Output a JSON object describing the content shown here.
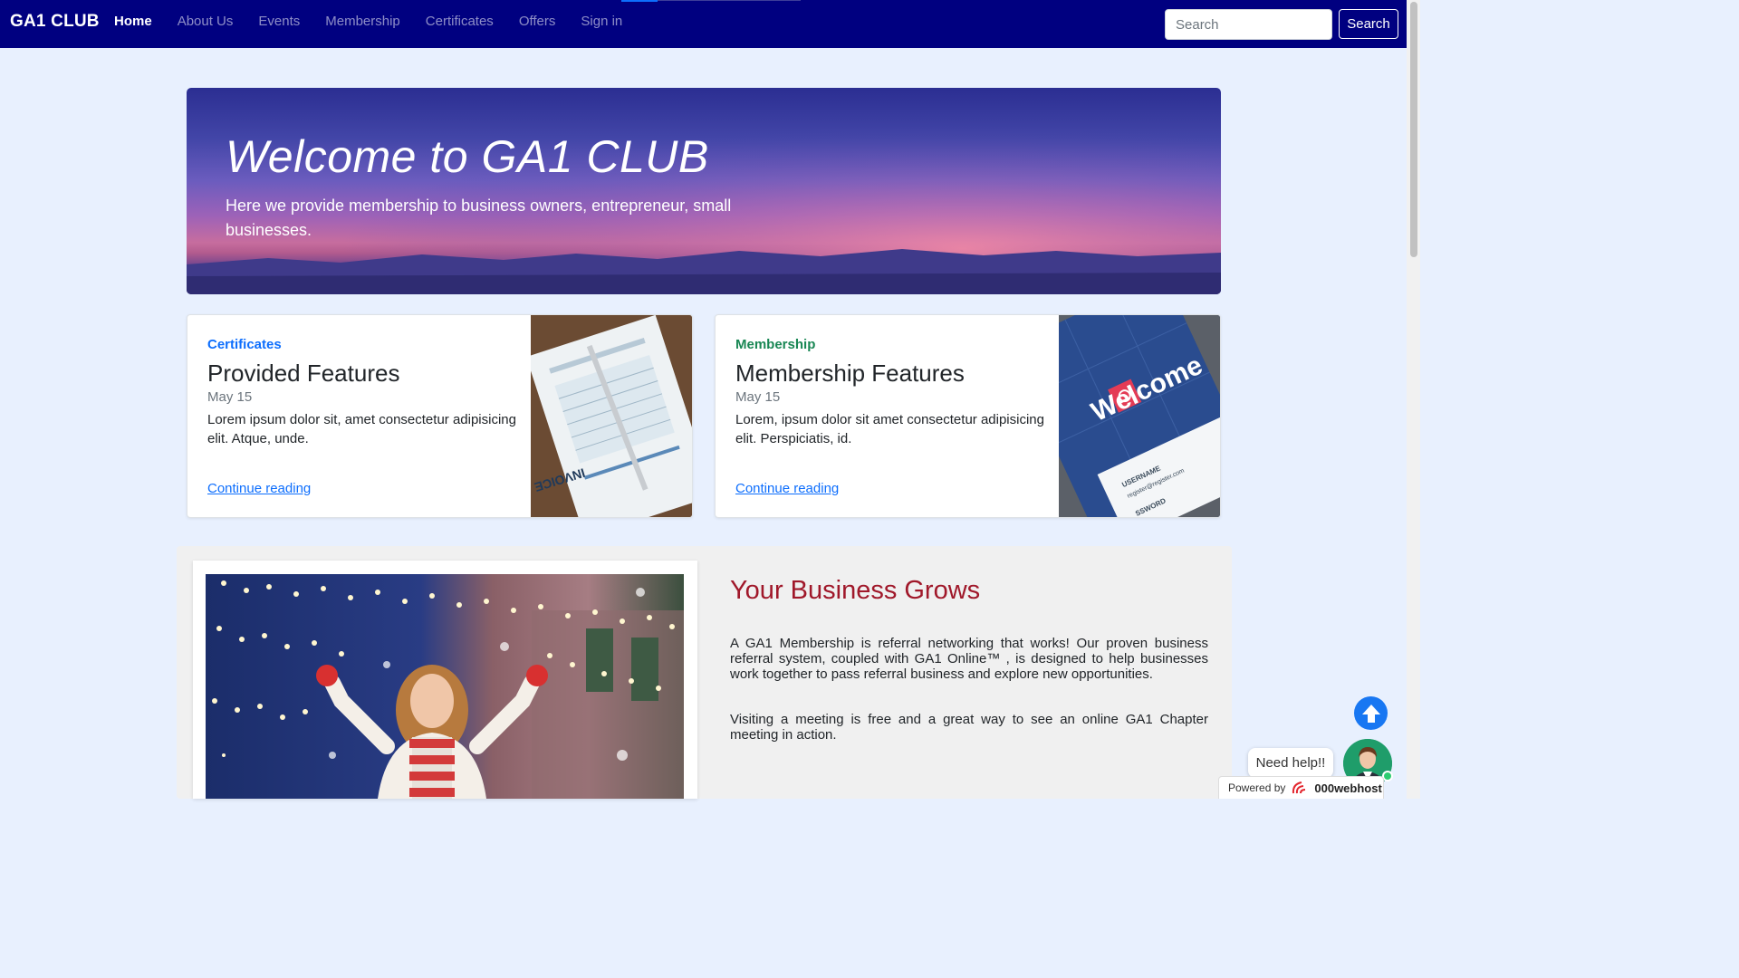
{
  "navbar": {
    "brand": "GA1 CLUB",
    "links": [
      {
        "label": "Home",
        "active": true
      },
      {
        "label": "About Us"
      },
      {
        "label": "Events"
      },
      {
        "label": "Membership"
      },
      {
        "label": "Certificates"
      },
      {
        "label": "Offers"
      },
      {
        "label": "Sign in"
      }
    ],
    "search_placeholder": "Search",
    "search_button": "Search"
  },
  "hero": {
    "title": "Welcome to GA1 CLUB",
    "subtitle": "Here we provide membership to business owners, entrepreneur, small businesses."
  },
  "cards": [
    {
      "category": "Certificates",
      "title": "Provided Features",
      "date": "May 15",
      "text": "Lorem ipsum dolor sit, amet consectetur adipisicing elit. Atque, unde.",
      "link": "Continue reading",
      "image": "invoice-clipboard",
      "image_text": "INVOICE"
    },
    {
      "category": "Membership",
      "title": "Membership Features",
      "date": "May 15",
      "text": "Lorem, ipsum dolor sit amet consectetur adipisicing elit. Perspiciatis, id.",
      "link": "Continue reading",
      "image": "welcome-login-screen",
      "image_text": "Welcome",
      "image_username": "USERNAME",
      "image_email": "register@register.com",
      "image_password": "SSWORD"
    }
  ],
  "feature": {
    "title": "Your Business Grows",
    "paragraph1": "A GA1 Membership is referral networking that works! Our proven business referral system, coupled with GA1 Online™ , is designed to help businesses work together to pass referral business and explore new opportunities.",
    "paragraph2": "Visiting a meeting is free and a great way to see an online GA1 Chapter meeting in action.",
    "image": "woman-snow-lights"
  },
  "widgets": {
    "help_text": "Need help!!",
    "powered_label": "Powered by",
    "powered_brand": "000webhost",
    "scroll_top_icon": "arrow-up-circle-icon",
    "accent_color": "#000080"
  }
}
